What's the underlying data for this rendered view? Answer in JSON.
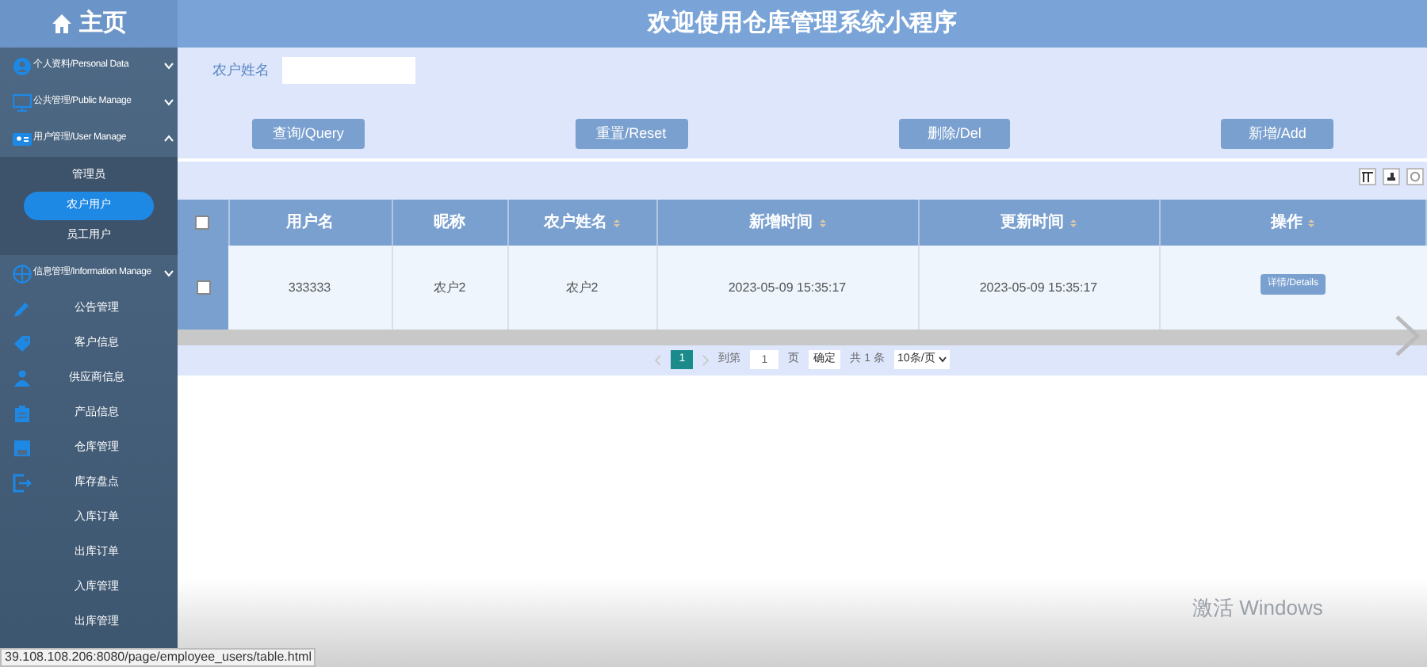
{
  "brand": {
    "title": "主页"
  },
  "header": {
    "title": "欢迎使用仓库管理系统小程序"
  },
  "sidebar": {
    "items": [
      {
        "label": "个人资料/Personal Data",
        "kind": "group",
        "expanded": false
      },
      {
        "label": "公共管理/Public Manage",
        "kind": "group",
        "expanded": false
      },
      {
        "label": "用户管理/User Manage",
        "kind": "group",
        "expanded": true,
        "children": [
          {
            "label": "管理员",
            "selected": false
          },
          {
            "label": "农户用户",
            "selected": true
          },
          {
            "label": "员工用户",
            "selected": false
          }
        ]
      },
      {
        "label": "信息管理/Information Manage",
        "kind": "group",
        "expanded": false
      },
      {
        "label": "公告管理",
        "kind": "link"
      },
      {
        "label": "客户信息",
        "kind": "link"
      },
      {
        "label": "供应商信息",
        "kind": "link"
      },
      {
        "label": "产品信息",
        "kind": "link"
      },
      {
        "label": "仓库管理",
        "kind": "link"
      },
      {
        "label": "库存盘点",
        "kind": "link"
      },
      {
        "label": "入库订单",
        "kind": "link"
      },
      {
        "label": "出库订单",
        "kind": "link"
      },
      {
        "label": "入库管理",
        "kind": "link"
      },
      {
        "label": "出库管理",
        "kind": "link"
      }
    ]
  },
  "search": {
    "label": "农户姓名"
  },
  "buttons": [
    "查询/Query",
    "重置/Reset",
    "删除/Del",
    "新增/Add"
  ],
  "table": {
    "all_checked": false,
    "columns": [
      {
        "label": "用户名",
        "sortable": false
      },
      {
        "label": "昵称",
        "sortable": false
      },
      {
        "label": "农户姓名",
        "sortable": true
      },
      {
        "label": "新增时间",
        "sortable": true
      },
      {
        "label": "更新时间",
        "sortable": true
      },
      {
        "label": "操作",
        "sortable": true
      }
    ],
    "rows": [
      {
        "checked": false,
        "cells": [
          "333333",
          "农户2",
          "农户2",
          "2023-05-09 15:35:17",
          "2023-05-09 15:35:17"
        ],
        "action": "详情/Details"
      }
    ]
  },
  "pagination": {
    "current": "1",
    "goto_label": "到第",
    "page_value": "1",
    "page_suffix": "页",
    "confirm": "确定",
    "total": "共 1 条",
    "page_size": "10条/页"
  },
  "os_notice": "激活 Windows",
  "status_url": "39.108.108.206:8080/page/employee_users/table.html"
}
